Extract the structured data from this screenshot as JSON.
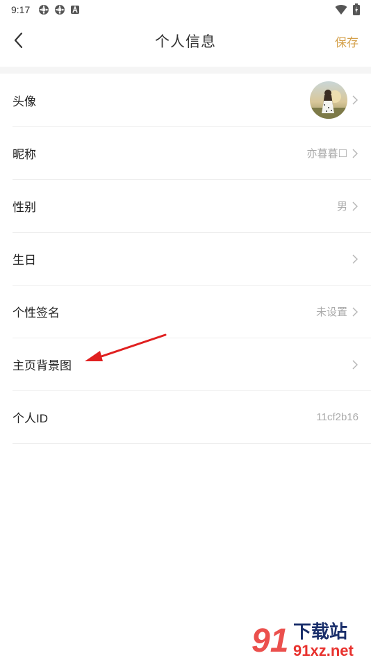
{
  "status_bar": {
    "time": "9:17",
    "left_icons": [
      "settings-gear-icon",
      "settings-gear-icon",
      "text-a-icon"
    ],
    "right_icons": [
      "wifi-icon",
      "battery-charging-icon"
    ]
  },
  "nav": {
    "title": "个人信息",
    "save_label": "保存",
    "accent_color": "#d4a04a"
  },
  "rows": [
    {
      "label": "头像",
      "value": "",
      "type": "avatar"
    },
    {
      "label": "昵称",
      "value": "亦暮暮☐"
    },
    {
      "label": "性别",
      "value": "男"
    },
    {
      "label": "生日",
      "value": ""
    },
    {
      "label": "个性签名",
      "value": "未设置"
    },
    {
      "label": "主页背景图",
      "value": ""
    },
    {
      "label": "个人ID",
      "value": "11cf2b16"
    }
  ],
  "annotation": {
    "arrow_color": "#e02020"
  },
  "watermark": {
    "brand": "下载站",
    "domain": "91xz.net",
    "logo_text": "91"
  }
}
